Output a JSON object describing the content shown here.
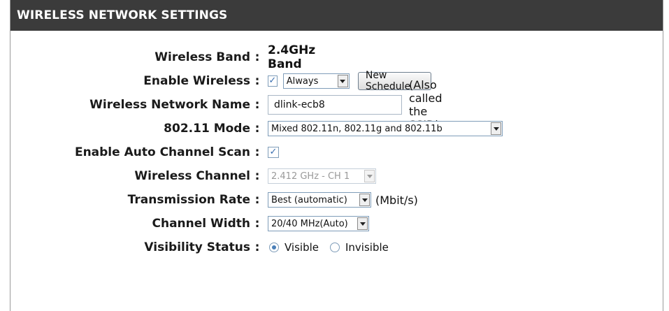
{
  "header": {
    "title": "WIRELESS NETWORK SETTINGS"
  },
  "rows": {
    "wireless_band": {
      "label": "Wireless Band",
      "value": "2.4GHz Band"
    },
    "enable_wireless": {
      "label": "Enable Wireless",
      "checked": true,
      "schedule_value": "Always",
      "new_schedule_label": "New Schedule"
    },
    "network_name": {
      "label": "Wireless Network Name",
      "value": "dlink-ecb8",
      "note": "(Also called the SSID)"
    },
    "mode": {
      "label": "802.11 Mode",
      "value": "Mixed 802.11n, 802.11g and 802.11b"
    },
    "auto_channel": {
      "label": "Enable Auto Channel Scan",
      "checked": true
    },
    "channel": {
      "label": "Wireless Channel",
      "value": "2.412 GHz - CH 1"
    },
    "tx_rate": {
      "label": "Transmission Rate",
      "value": "Best (automatic)",
      "unit": "(Mbit/s)"
    },
    "width": {
      "label": "Channel Width",
      "value": "20/40 MHz(Auto)"
    },
    "visibility": {
      "label": "Visibility Status",
      "visible_label": "Visible",
      "invisible_label": "Invisible",
      "selected": "Visible"
    }
  },
  "separator": ":",
  "check_glyph": "✓",
  "colors": {
    "header_bg": "#3b3b3b",
    "header_text": "#ffffff",
    "accent": "#3a6fb0"
  }
}
